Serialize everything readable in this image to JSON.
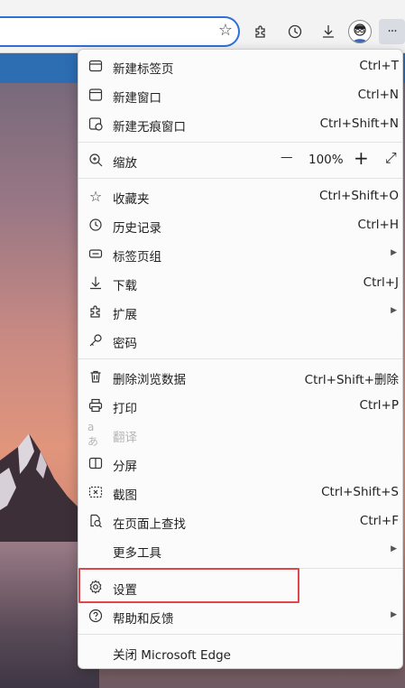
{
  "menu": {
    "new_tab": {
      "label": "新建标签页",
      "shortcut": "Ctrl+T"
    },
    "new_window": {
      "label": "新建窗口",
      "shortcut": "Ctrl+N"
    },
    "new_inprivate": {
      "label": "新建无痕窗口",
      "shortcut": "Ctrl+Shift+N"
    },
    "zoom": {
      "label": "缩放",
      "minus": "—",
      "value": "100%",
      "plus": "+",
      "fullscreen": "⤢"
    },
    "favorites": {
      "label": "收藏夹",
      "shortcut": "Ctrl+Shift+O"
    },
    "history": {
      "label": "历史记录",
      "shortcut": "Ctrl+H"
    },
    "collections": {
      "label": "标签页组"
    },
    "downloads": {
      "label": "下载",
      "shortcut": "Ctrl+J"
    },
    "extensions": {
      "label": "扩展"
    },
    "passwords": {
      "label": "密码"
    },
    "clear_data": {
      "label": "删除浏览数据",
      "shortcut": "Ctrl+Shift+删除"
    },
    "print": {
      "label": "打印",
      "shortcut": "Ctrl+P"
    },
    "translate": {
      "label": "翻译"
    },
    "split_screen": {
      "label": "分屏"
    },
    "screenshot": {
      "label": "截图",
      "shortcut": "Ctrl+Shift+S"
    },
    "find": {
      "label": "在页面上查找",
      "shortcut": "Ctrl+F"
    },
    "more_tools": {
      "label": "更多工具"
    },
    "settings": {
      "label": "设置"
    },
    "help": {
      "label": "帮助和反馈"
    },
    "close": {
      "label": "关闭 Microsoft Edge"
    }
  },
  "toolbar": {
    "more": "···"
  },
  "colors": {
    "highlight": "#e0474c",
    "address_border": "#2f6fd6"
  }
}
